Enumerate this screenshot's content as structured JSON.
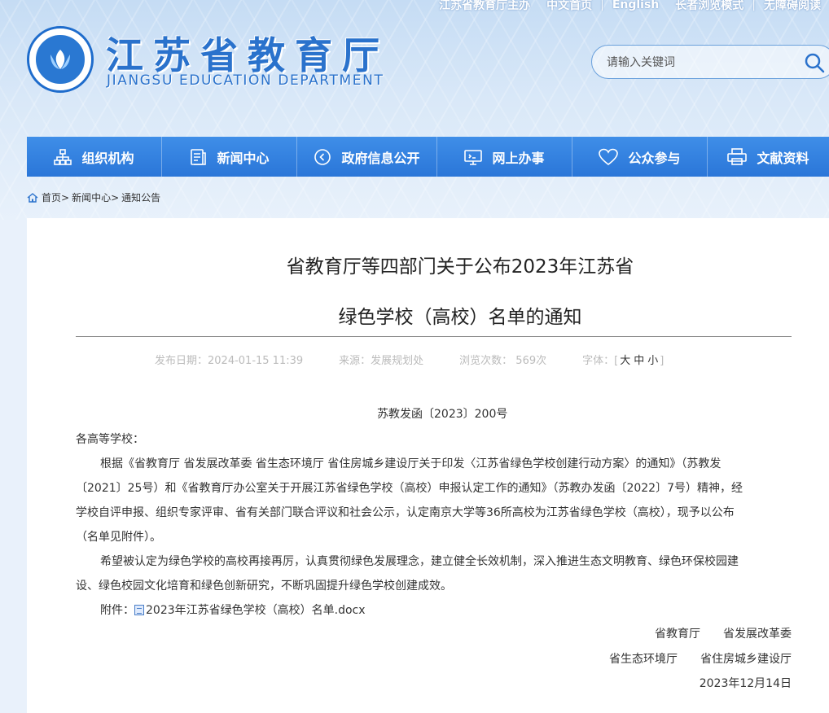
{
  "topbar": {
    "host": "江苏省教育厅主办",
    "chinese_home": "中文首页",
    "english": "English",
    "elder_mode": "长者浏览模式",
    "accessible": "无障碍阅读"
  },
  "site": {
    "title": "江苏省教育厅",
    "subtitle": "JIANGSU EDUCATION DEPARTMENT"
  },
  "search": {
    "placeholder": "请输入关键词",
    "icon": "search-icon"
  },
  "nav": {
    "items": [
      {
        "label": "组织机构",
        "icon": "org-chart-icon"
      },
      {
        "label": "新闻中心",
        "icon": "document-icon"
      },
      {
        "label": "政府信息公开",
        "icon": "play-circle-icon"
      },
      {
        "label": "网上办事",
        "icon": "monitor-icon"
      },
      {
        "label": "公众参与",
        "icon": "heart-icon"
      },
      {
        "label": "文献资料",
        "icon": "printer-icon"
      }
    ]
  },
  "breadcrumb": {
    "home": "首页",
    "news": "新闻中心",
    "notices": "通知公告",
    "sep": ">"
  },
  "article": {
    "title_line1": "省教育厅等四部门关于公布2023年江苏省",
    "title_line2": "绿色学校（高校）名单的通知",
    "meta": {
      "date": "发布日期：2024-01-15 11:39",
      "source": "来源：发展规划处",
      "views": "浏览次数： 569次",
      "font_label": "字体：",
      "font_open": "[",
      "font_large": "大",
      "font_medium": "中",
      "font_small": "小",
      "font_close": "]"
    },
    "doc_number": "苏教发函〔2023〕200号",
    "salutation": "各高等学校：",
    "para1": [
      "根据《省教育厅 省发展改革委 省生态环境厅 省住房城乡建设厅关于印发〈江苏省绿色学校创建行动方案〉的通知》（苏教发",
      "〔2021〕25号）和《省教育厅办公室关于开展江苏省绿色学校（高校）申报认定工作的通知》（苏教办发函〔2022〕7号）精神，经",
      "学校自评申报、组织专家评审、省有关部门联合评议和社会公示，认定南京大学等36所高校为江苏省绿色学校（高校），现予以公布",
      "（名单见附件）。"
    ],
    "para2": [
      "希望被认定为绿色学校的高校再接再厉，认真贯彻绿色发展理念，建立健全长效机制，深入推进生态文明教育、绿色环保校园建",
      "设、绿色校园文化培育和绿色创新研究，不断巩固提升绿色学校创建成效。"
    ],
    "attachment_label": "附件：",
    "attachment_file": "2023年江苏省绿色学校（高校）名单.docx",
    "signatures": [
      "省教育厅　　省发展改革委",
      "省生态环境厅　　省住房城乡建设厅"
    ],
    "sign_date": "2023年12月14日"
  }
}
